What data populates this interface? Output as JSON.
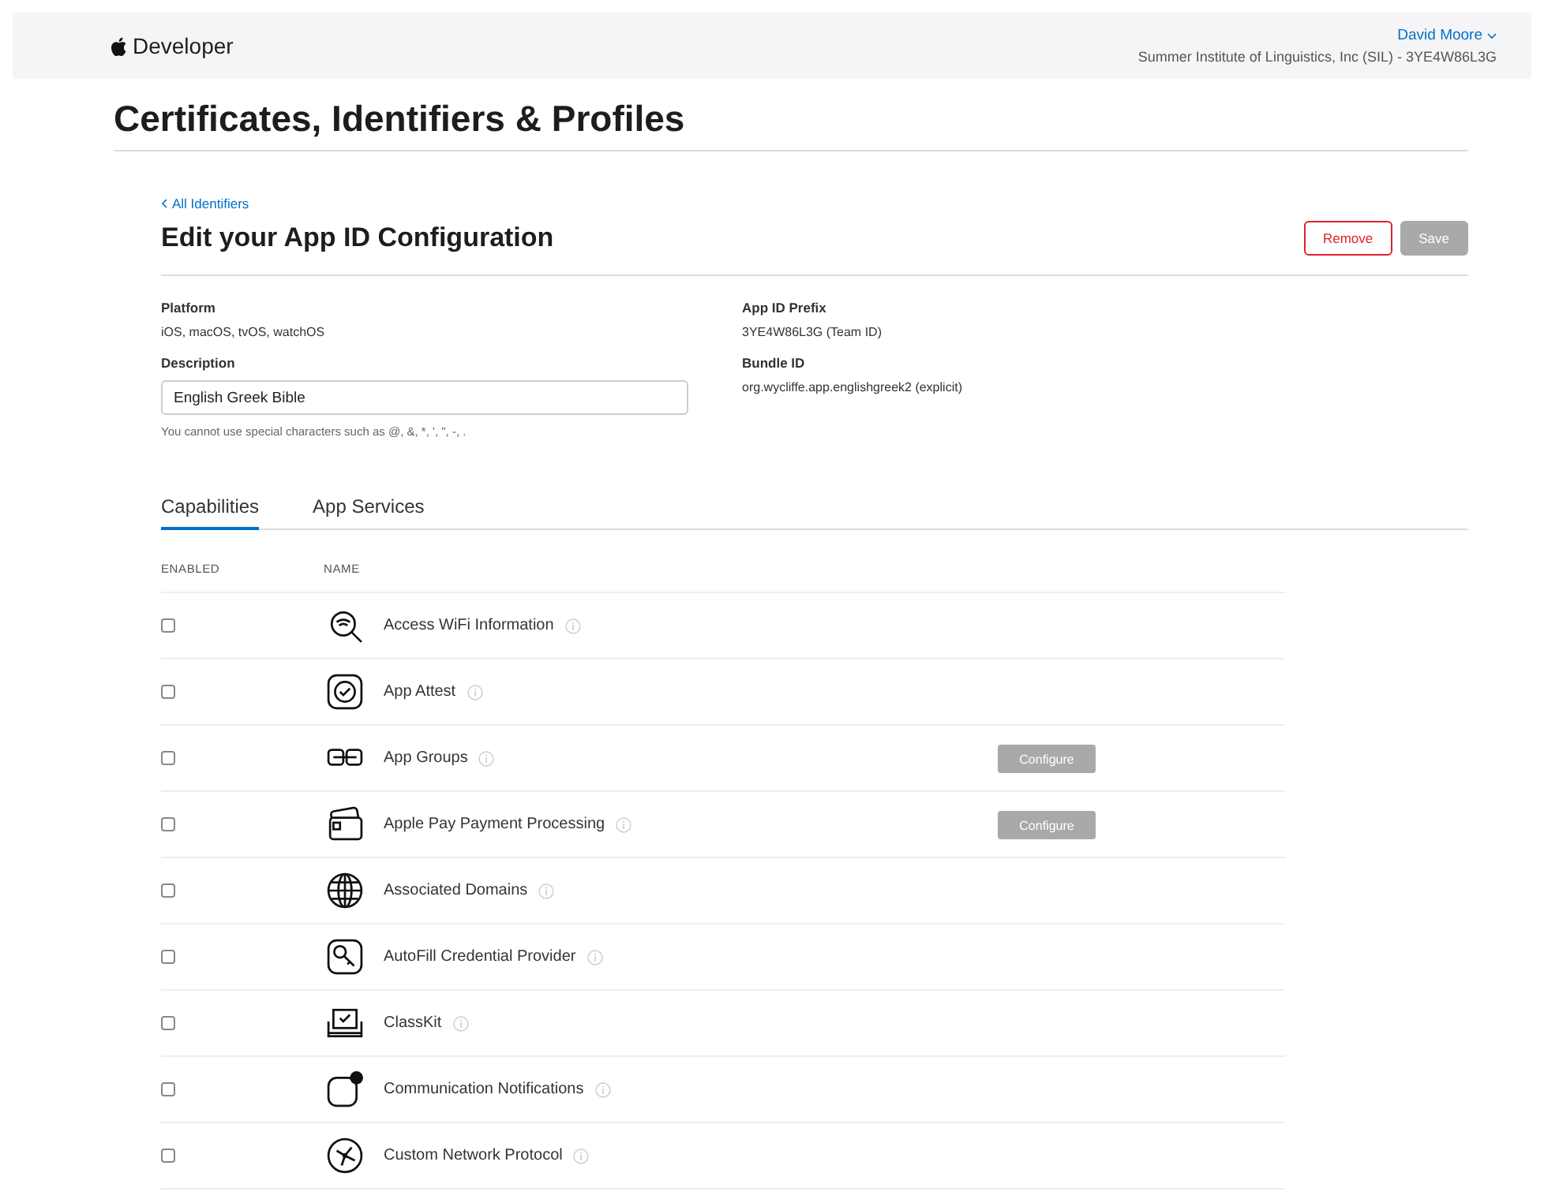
{
  "header": {
    "brand": "Developer",
    "user": "David Moore",
    "team": "Summer Institute of Linguistics, Inc (SIL) - 3YE4W86L3G"
  },
  "page_title": "Certificates, Identifiers & Profiles",
  "back_link": "All Identifiers",
  "heading": "Edit your App ID Configuration",
  "buttons": [
    {
      "label": "Remove",
      "kind": "danger"
    },
    {
      "label": "Save",
      "kind": "primary",
      "disabled": true
    }
  ],
  "platform": {
    "label": "Platform",
    "value": "iOS, macOS, tvOS, watchOS"
  },
  "description": {
    "label": "Description",
    "value": "English Greek Bible",
    "hint": "You cannot use special characters such as @, &, *, ', \", -, ."
  },
  "app_id_prefix": {
    "label": "App ID Prefix",
    "value": "3YE4W86L3G (Team ID)"
  },
  "bundle_id": {
    "label": "Bundle ID",
    "value": "org.wycliffe.app.englishgreek2 (explicit)"
  },
  "tabs": [
    {
      "label": "Capabilities",
      "selected": true
    },
    {
      "label": "App Services",
      "selected": false
    }
  ],
  "columns": [
    "ENABLED",
    "NAME"
  ],
  "capabilities": [
    {
      "name": "Access WiFi Information",
      "kind": "wifi",
      "checked": false
    },
    {
      "name": "App Attest",
      "kind": "attest",
      "checked": false
    },
    {
      "name": "App Groups",
      "kind": "groups",
      "checked": false,
      "configure": {
        "label": "Configure",
        "disabled": true
      }
    },
    {
      "name": "Apple Pay Payment Processing",
      "kind": "pay",
      "checked": false,
      "configure": {
        "label": "Configure",
        "disabled": true
      }
    },
    {
      "name": "Associated Domains",
      "kind": "globe",
      "checked": false
    },
    {
      "name": "AutoFill Credential Provider",
      "kind": "key",
      "checked": false
    },
    {
      "name": "ClassKit",
      "kind": "classkit",
      "checked": false
    },
    {
      "name": "Communication Notifications",
      "kind": "notify",
      "checked": false
    },
    {
      "name": "Custom Network Protocol",
      "kind": "network",
      "checked": false
    }
  ]
}
